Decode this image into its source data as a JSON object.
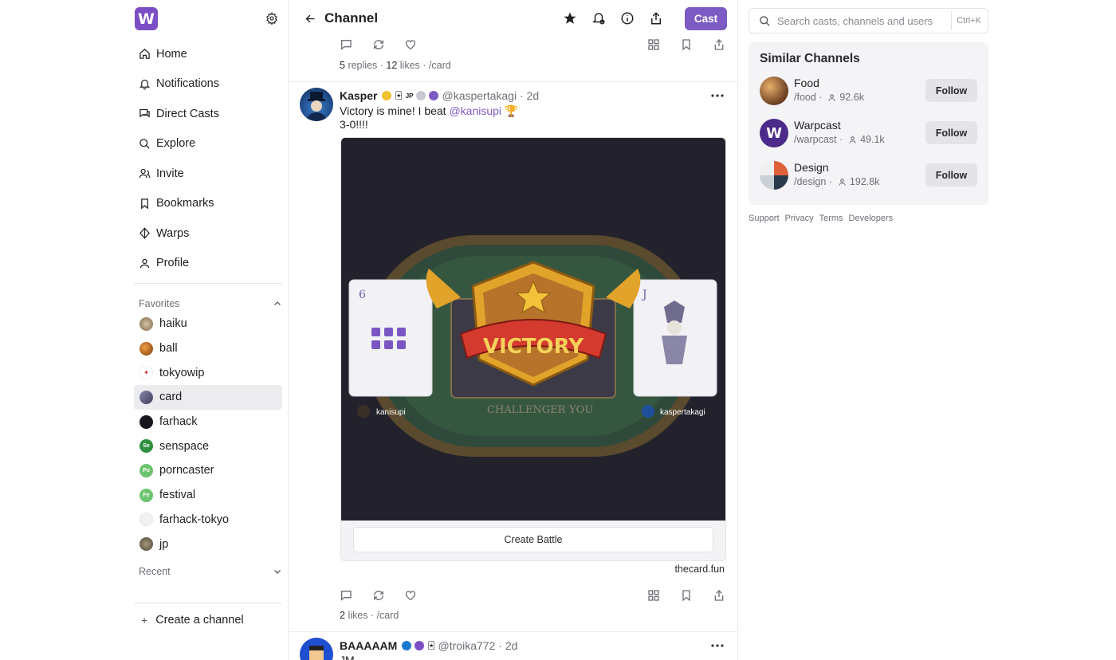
{
  "sidebar": {
    "logo_letter": "W",
    "nav": [
      {
        "label": "Home",
        "icon": "home-icon"
      },
      {
        "label": "Notifications",
        "icon": "bell-icon"
      },
      {
        "label": "Direct Casts",
        "icon": "chat-icon"
      },
      {
        "label": "Explore",
        "icon": "search-icon"
      },
      {
        "label": "Invite",
        "icon": "user-plus-icon"
      },
      {
        "label": "Bookmarks",
        "icon": "bookmark-icon"
      },
      {
        "label": "Warps",
        "icon": "diamond-icon"
      },
      {
        "label": "Profile",
        "icon": "user-icon"
      }
    ],
    "favorites_label": "Favorites",
    "favorites": [
      {
        "label": "haiku",
        "color": "#b49a7a",
        "abbr": ""
      },
      {
        "label": "ball",
        "color": "#c2732f",
        "abbr": ""
      },
      {
        "label": "tokyowip",
        "color": "#ffffff",
        "abbr": ""
      },
      {
        "label": "card",
        "color": "#6b6a8a",
        "abbr": ""
      },
      {
        "label": "farhack",
        "color": "#16161c",
        "abbr": ""
      },
      {
        "label": "senspace",
        "color": "#2f8f3f",
        "abbr": "Se"
      },
      {
        "label": "porncaster",
        "color": "#6cc46f",
        "abbr": "Po"
      },
      {
        "label": "festival",
        "color": "#6cc46f",
        "abbr": "Fe"
      },
      {
        "label": "farhack-tokyo",
        "color": "#f4f4f6",
        "abbr": ""
      },
      {
        "label": "jp",
        "color": "#7b7060",
        "abbr": ""
      }
    ],
    "active_favorite": "card",
    "recent_label": "Recent",
    "create_label": "Create a channel"
  },
  "header": {
    "title": "Channel",
    "cast_label": "Cast"
  },
  "post0": {
    "replies": "5",
    "replies_label": "replies",
    "likes": "12",
    "likes_label": "likes",
    "channel": "/card"
  },
  "post1": {
    "name": "Kasper",
    "handle": "@kaspertakagi",
    "time": "2d",
    "text_before": "Victory is mine! I beat ",
    "mention": "@kanisupi",
    "text_emoji": " 🏆",
    "text_line2": " 3-0!!!!",
    "frame": {
      "banner": "VICTORY",
      "left_card_rank": "6",
      "right_card_rank": "J",
      "left_player": "kanisupi",
      "right_player": "kaspertakagi",
      "left_label": "CHALLENGER",
      "right_label": "YOU",
      "button_label": "Create Battle",
      "domain": "thecard.fun"
    },
    "likes": "2",
    "likes_label": "likes",
    "channel": "/card"
  },
  "post2": {
    "name": "BAAAAAM",
    "handle": "@troika772",
    "time": "2d",
    "text": "JM"
  },
  "right": {
    "search_placeholder": "Search casts, channels and users",
    "shortcut": "Ctrl+K",
    "similar_title": "Similar Channels",
    "channels": [
      {
        "name": "Food",
        "path": "/food",
        "members": "92.6k",
        "follow": "Follow"
      },
      {
        "name": "Warpcast",
        "path": "/warpcast",
        "members": "49.1k",
        "follow": "Follow"
      },
      {
        "name": "Design",
        "path": "/design",
        "members": "192.8k",
        "follow": "Follow"
      }
    ],
    "footer_links": [
      "Support",
      "Privacy",
      "Terms",
      "Developers"
    ]
  },
  "colors": {
    "accent": "#7c5bc4",
    "logo": "#7c4ec5"
  }
}
